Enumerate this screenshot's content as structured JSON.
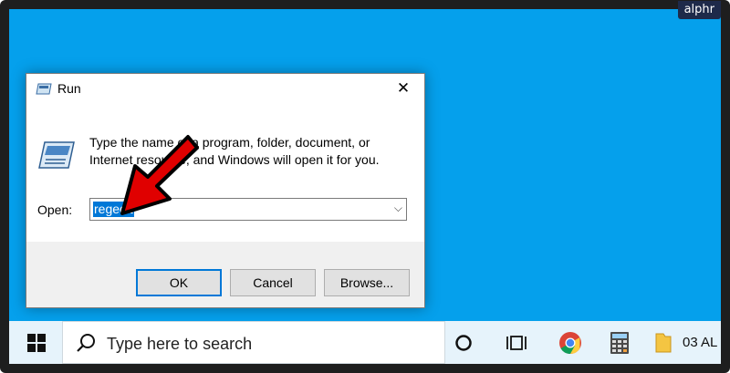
{
  "watermark": "alphr",
  "dialog": {
    "title": "Run",
    "description": "Type the name of a program, folder, document, or Internet resource, and Windows will open it for you.",
    "open_label": "Open:",
    "open_value": "regedit",
    "ok_label": "OK",
    "cancel_label": "Cancel",
    "browse_label": "Browse...",
    "close_glyph": "✕"
  },
  "taskbar": {
    "search_placeholder": "Type here to search",
    "folder_label": "03 AL",
    "icons": [
      "windows-start-icon",
      "search-icon",
      "cortana-icon",
      "task-view-icon",
      "chrome-icon",
      "calculator-icon",
      "folder-icon"
    ]
  },
  "colors": {
    "desktop": "#05a0ec",
    "accent": "#0078d7",
    "taskbar": "#e6f3fb",
    "arrow": "#e00000"
  }
}
